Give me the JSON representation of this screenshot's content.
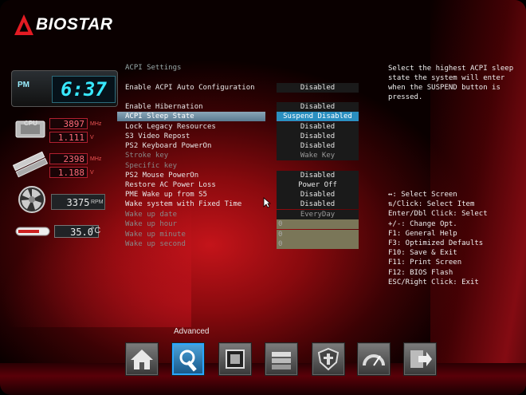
{
  "brand": {
    "name": "BIOSTAR",
    "color": "#e31b23"
  },
  "status": {
    "ampm": "PM",
    "time": "6:37",
    "cpu_label": "CPU",
    "cpu_freq": "3897",
    "cpu_freq_unit": "MHz",
    "cpu_volt": "1.111",
    "cpu_volt_unit": "V",
    "mem_freq": "2398",
    "mem_freq_unit": "MHz",
    "mem_volt": "1.188",
    "mem_volt_unit": "V",
    "fan_rpm": "3375",
    "fan_unit": "RPM",
    "temp": "35.0",
    "temp_unit": "°C"
  },
  "section": {
    "title": "ACPI Settings"
  },
  "settings": [
    {
      "name": "Enable ACPI Auto Configuration",
      "value": "Disabled",
      "state": "normal"
    },
    {
      "name": "Enable Hibernation",
      "value": "Disabled",
      "state": "normal"
    },
    {
      "name": "ACPI Sleep State",
      "value": "Suspend Disabled",
      "state": "selected"
    },
    {
      "name": "Lock Legacy Resources",
      "value": "Disabled",
      "state": "normal"
    },
    {
      "name": "S3 Video Repost",
      "value": "Disabled",
      "state": "normal"
    },
    {
      "name": "PS2 Keyboard PowerOn",
      "value": "Disabled",
      "state": "normal"
    },
    {
      "name": "Stroke key",
      "value": "Wake Key",
      "state": "dim"
    },
    {
      "name": "Specific key",
      "value": "",
      "state": "dim"
    },
    {
      "name": "PS2 Mouse PowerOn",
      "value": "Disabled",
      "state": "normal"
    },
    {
      "name": "Restore AC Power Loss",
      "value": "Power Off",
      "state": "normal"
    },
    {
      "name": "PME Wake up from S5",
      "value": "Disabled",
      "state": "normal"
    },
    {
      "name": "Wake system with Fixed Time",
      "value": "Disabled",
      "state": "normal"
    },
    {
      "name": "Wake up date",
      "value": "EveryDay",
      "state": "dim"
    },
    {
      "name": "Wake up hour",
      "value": "0",
      "state": "input"
    },
    {
      "name": "Wake up minute",
      "value": "0",
      "state": "input"
    },
    {
      "name": "Wake up second",
      "value": "0",
      "state": "input"
    }
  ],
  "help": {
    "description": "Select the highest ACPI sleep state the system will enter when the SUSPEND button is pressed."
  },
  "keys": [
    "↔: Select Screen",
    "⇅/Click: Select Item",
    "Enter/Dbl Click: Select",
    "+/-: Change Opt.",
    "F1: General Help",
    "F3: Optimized Defaults",
    "F10: Save & Exit",
    "F11: Print Screen",
    "F12: BIOS Flash",
    "ESC/Right Click: Exit"
  ],
  "nav": {
    "active_label": "Advanced",
    "tabs": [
      {
        "id": "main",
        "icon": "home-icon"
      },
      {
        "id": "advanced",
        "icon": "wrench-icon",
        "active": true
      },
      {
        "id": "chipset",
        "icon": "chip-icon"
      },
      {
        "id": "boot",
        "icon": "disk-stack-icon"
      },
      {
        "id": "security",
        "icon": "shield-icon"
      },
      {
        "id": "o-n-e",
        "icon": "gauge-icon"
      },
      {
        "id": "save-exit",
        "icon": "exit-icon"
      }
    ]
  }
}
